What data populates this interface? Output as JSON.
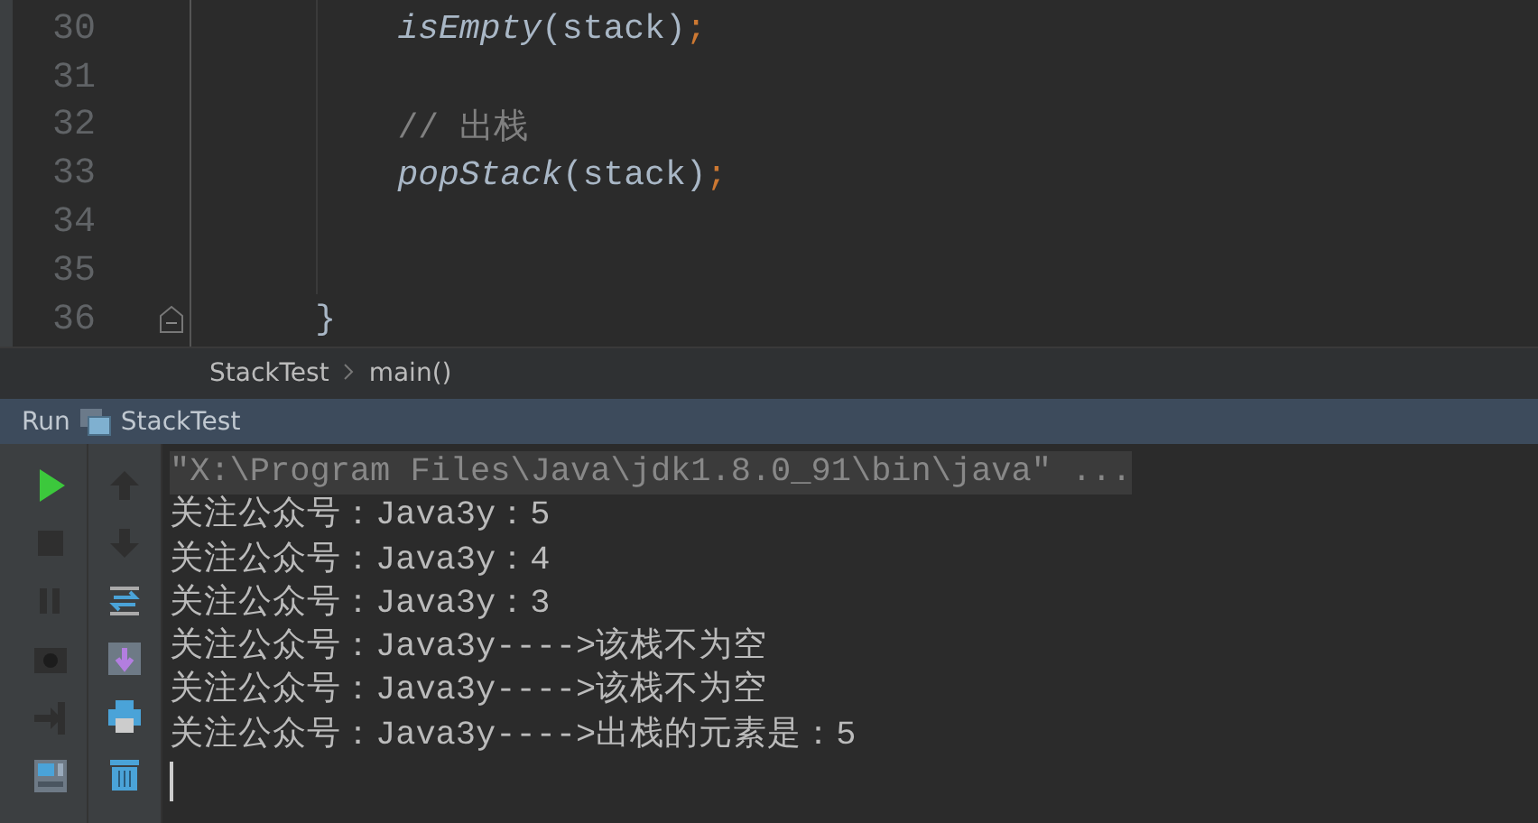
{
  "editor": {
    "lines": [
      {
        "number": "30",
        "tokens": [
          {
            "text": "        isEmpty",
            "kind": "method"
          },
          {
            "text": "(stack)",
            "kind": "plain"
          },
          {
            "text": ";",
            "kind": "punct"
          }
        ]
      },
      {
        "number": "31"
      },
      {
        "number": "32",
        "tokens": [
          {
            "text": "        // 出栈",
            "kind": "comment"
          }
        ]
      },
      {
        "number": "33",
        "tokens": [
          {
            "text": "        popStack",
            "kind": "method"
          },
          {
            "text": "(stack)",
            "kind": "plain"
          },
          {
            "text": ";",
            "kind": "punct"
          }
        ]
      },
      {
        "number": "34"
      },
      {
        "number": "35"
      },
      {
        "number": "36",
        "fold": true,
        "tokens": [
          {
            "text": "    }",
            "kind": "plain"
          }
        ]
      }
    ]
  },
  "breadcrumbs": [
    "StackTest",
    "main()"
  ],
  "run_panel": {
    "label": "Run",
    "config": "StackTest",
    "tools_left": [
      {
        "kind": "run",
        "disabled": false
      },
      {
        "kind": "stop",
        "disabled": true
      },
      {
        "kind": "pause",
        "disabled": true
      },
      {
        "kind": "dump",
        "disabled": true
      },
      {
        "kind": "exit",
        "disabled": true
      },
      {
        "kind": "layout",
        "disabled": false
      }
    ],
    "tools_right": [
      {
        "kind": "up",
        "disabled": true
      },
      {
        "kind": "down",
        "disabled": true
      },
      {
        "kind": "wrap",
        "disabled": false
      },
      {
        "kind": "scroll",
        "disabled": false
      },
      {
        "kind": "print",
        "disabled": false
      },
      {
        "kind": "trash",
        "disabled": false
      }
    ],
    "console": [
      {
        "kind": "command",
        "text": "\"X:\\Program Files\\Java\\jdk1.8.0_91\\bin\\java\" ..."
      },
      {
        "kind": "output",
        "text": "关注公众号：Java3y：5"
      },
      {
        "kind": "output",
        "text": "关注公众号：Java3y：4"
      },
      {
        "kind": "output",
        "text": "关注公众号：Java3y：3"
      },
      {
        "kind": "output",
        "text": "关注公众号：Java3y---->该栈不为空"
      },
      {
        "kind": "output",
        "text": "关注公众号：Java3y---->该栈不为空"
      },
      {
        "kind": "output",
        "text": "关注公众号：Java3y---->出栈的元素是：5"
      }
    ]
  }
}
